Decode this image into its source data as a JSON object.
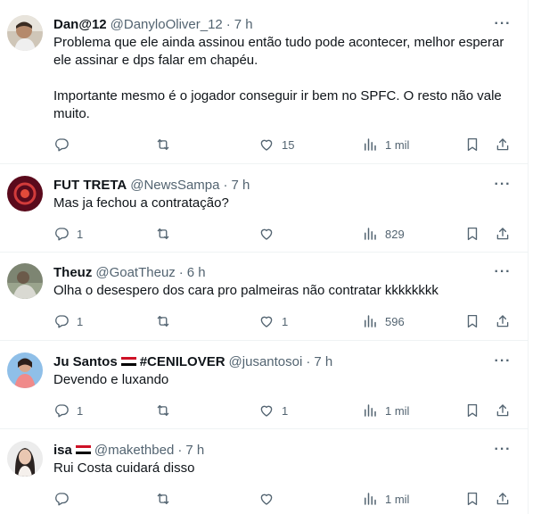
{
  "tweets": [
    {
      "name": "Dan@12",
      "handle": "@DanyloOliver_12",
      "time": "7 h",
      "text": "Problema que ele ainda assinou então tudo pode acontecer, melhor esperar ele assinar e dps falar em chapéu.\n\nImportante mesmo é o jogador conseguir ir bem no SPFC. O resto não vale muito.",
      "replies": "",
      "retweets": "",
      "likes": "15",
      "views": "1 mil"
    },
    {
      "name": "FUT TRETA",
      "handle": "@NewsSampa",
      "time": "7 h",
      "text": "Mas ja fechou a contratação?",
      "replies": "1",
      "retweets": "",
      "likes": "",
      "views": "829"
    },
    {
      "name": "Theuz",
      "handle": "@GoatTheuz",
      "time": "6 h",
      "text": "Olha o desespero dos cara pro palmeiras não contratar kkkkkkkk",
      "replies": "1",
      "retweets": "",
      "likes": "1",
      "views": "596"
    },
    {
      "name": "Ju Santos",
      "name_suffix": "#CENILOVER",
      "handle": "@jusantosoi",
      "time": "7 h",
      "text": "Devendo e luxando",
      "replies": "1",
      "retweets": "",
      "likes": "1",
      "views": "1 mil"
    },
    {
      "name": "isa",
      "handle": "@makethbed",
      "time": "7 h",
      "text": "Rui Costa cuidará disso",
      "replies": "",
      "retweets": "",
      "likes": "",
      "views": "1 mil"
    }
  ],
  "icons": {
    "reply": "reply-icon",
    "retweet": "retweet-icon",
    "like": "heart-icon",
    "views": "views-chart-icon",
    "bookmark": "bookmark-icon",
    "share": "share-icon",
    "more": "more-icon"
  },
  "colors": {
    "text": "#0f1419",
    "secondary": "#536471",
    "divider": "#eff3f4",
    "flag_red": "#ce1126",
    "flag_white": "#ffffff",
    "flag_black": "#000000"
  }
}
